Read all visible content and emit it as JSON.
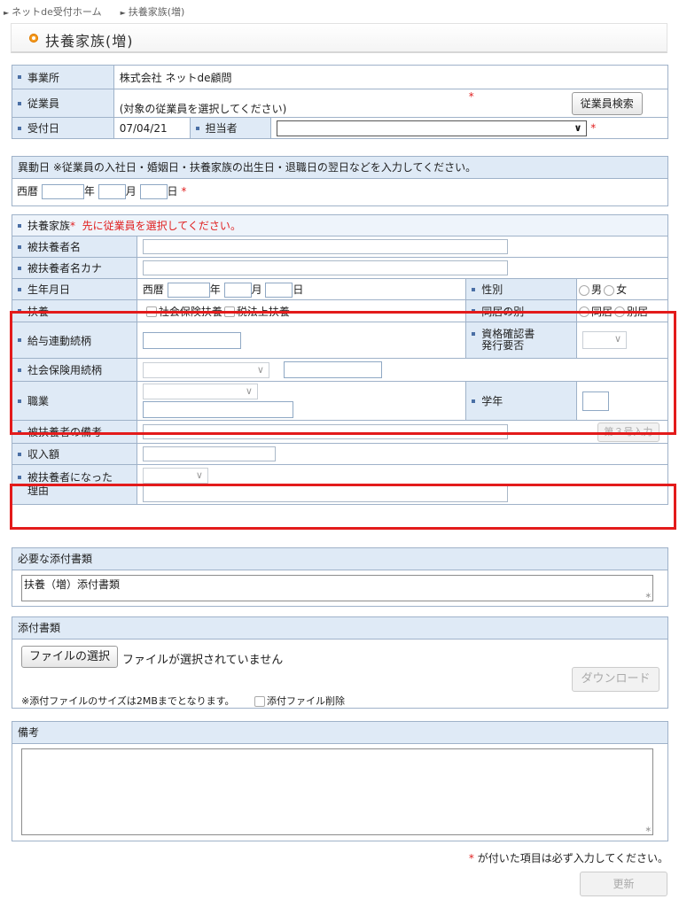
{
  "breadcrumb": [
    "ネットde受付ホーム",
    "扶養家族(増)"
  ],
  "page_title": "扶養家族(増)",
  "top": {
    "office_label": "事業所",
    "office_value": "株式会社 ネットde顧問",
    "employee_label": "従業員",
    "employee_hint": "(対象の従業員を選択してください)",
    "employee_required": "*",
    "employee_search_button": "従業員検索",
    "received_label": "受付日",
    "received_value": "07/04/21",
    "staff_label": "担当者",
    "staff_value": "",
    "staff_required": "*"
  },
  "change_date": {
    "title": "異動日 ※従業員の入社日・婚姻日・扶養家族の出生日・退職日の翌日などを入力してください。",
    "era": "西暦",
    "year_unit": "年",
    "month_unit": "月",
    "day_unit": "日",
    "required": "*"
  },
  "dependent": {
    "header_label": "扶養家族",
    "header_required": "*",
    "header_notice": "先に従業員を選択してください。",
    "name_label": "被扶養者名",
    "kana_label": "被扶養者名カナ",
    "birth_label": "生年月日",
    "birth_era": "西暦",
    "birth_year_unit": "年",
    "birth_month_unit": "月",
    "birth_day_unit": "日",
    "gender_label": "性別",
    "gender_options": [
      "男",
      "女"
    ],
    "support_label": "扶養",
    "support_options": [
      "社会保険扶養",
      "税法上扶養"
    ],
    "cohabit_label": "同居の別",
    "cohabit_options": [
      "同居",
      "別居"
    ],
    "payroll_relation_label": "給与連動続柄",
    "cert_label_line1": "資格確認書",
    "cert_label_line2": "発行要否",
    "social_relation_label": "社会保険用続柄",
    "occupation_label": "職業",
    "grade_label": "学年",
    "remarks_label": "被扶養者の備考",
    "no3_button": "第３号入力",
    "income_label": "収入額",
    "reason_label_line1": "被扶養者になった",
    "reason_label_line2": "理由"
  },
  "required_docs": {
    "title": "必要な添付書類",
    "value": "扶養（増）添付書類"
  },
  "attachments": {
    "title": "添付書類",
    "choose_button": "ファイルの選択",
    "no_file_text": "ファイルが選択されていません",
    "download_button": "ダウンロード",
    "size_note": "※添付ファイルのサイズは2MBまでとなります。",
    "delete_label": "添付ファイル削除"
  },
  "notes": {
    "title": "備考"
  },
  "footer": {
    "required_mark": "*",
    "required_note": "が付いた項目は必ず入力してください。",
    "update_button": "更新"
  },
  "colors": {
    "label_bg": "#dfeaf6",
    "border": "#9fb2c9",
    "required": "#e02020",
    "highlight": "#e31b1b",
    "title_dot": "#f39a1e"
  }
}
